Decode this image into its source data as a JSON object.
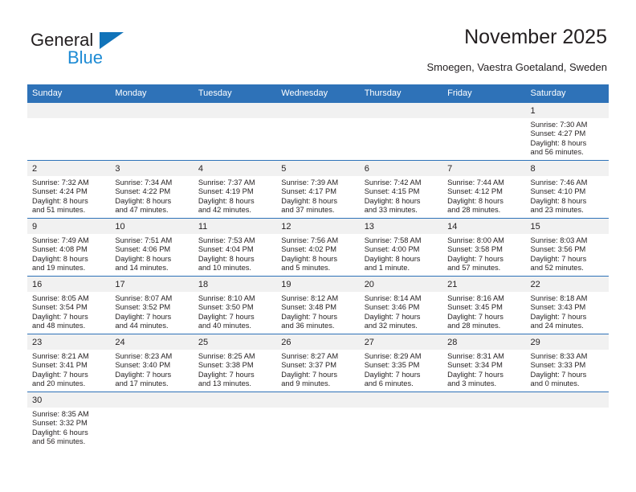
{
  "brand": {
    "name_top": "General",
    "name_bottom": "Blue"
  },
  "header": {
    "title": "November 2025",
    "subtitle": "Smoegen, Vaestra Goetaland, Sweden"
  },
  "colors": {
    "header_blue": "#2e72b8",
    "daynum_gray": "#f1f1f1",
    "logo_blue": "#1e8bd4",
    "text": "#231f20"
  },
  "calendar": {
    "weekday_headers": [
      "Sunday",
      "Monday",
      "Tuesday",
      "Wednesday",
      "Thursday",
      "Friday",
      "Saturday"
    ],
    "weeks": [
      [
        {
          "day": "",
          "sunrise": "",
          "sunset": "",
          "daylight1": "",
          "daylight2": ""
        },
        {
          "day": "",
          "sunrise": "",
          "sunset": "",
          "daylight1": "",
          "daylight2": ""
        },
        {
          "day": "",
          "sunrise": "",
          "sunset": "",
          "daylight1": "",
          "daylight2": ""
        },
        {
          "day": "",
          "sunrise": "",
          "sunset": "",
          "daylight1": "",
          "daylight2": ""
        },
        {
          "day": "",
          "sunrise": "",
          "sunset": "",
          "daylight1": "",
          "daylight2": ""
        },
        {
          "day": "",
          "sunrise": "",
          "sunset": "",
          "daylight1": "",
          "daylight2": ""
        },
        {
          "day": "1",
          "sunrise": "Sunrise: 7:30 AM",
          "sunset": "Sunset: 4:27 PM",
          "daylight1": "Daylight: 8 hours",
          "daylight2": "and 56 minutes."
        }
      ],
      [
        {
          "day": "2",
          "sunrise": "Sunrise: 7:32 AM",
          "sunset": "Sunset: 4:24 PM",
          "daylight1": "Daylight: 8 hours",
          "daylight2": "and 51 minutes."
        },
        {
          "day": "3",
          "sunrise": "Sunrise: 7:34 AM",
          "sunset": "Sunset: 4:22 PM",
          "daylight1": "Daylight: 8 hours",
          "daylight2": "and 47 minutes."
        },
        {
          "day": "4",
          "sunrise": "Sunrise: 7:37 AM",
          "sunset": "Sunset: 4:19 PM",
          "daylight1": "Daylight: 8 hours",
          "daylight2": "and 42 minutes."
        },
        {
          "day": "5",
          "sunrise": "Sunrise: 7:39 AM",
          "sunset": "Sunset: 4:17 PM",
          "daylight1": "Daylight: 8 hours",
          "daylight2": "and 37 minutes."
        },
        {
          "day": "6",
          "sunrise": "Sunrise: 7:42 AM",
          "sunset": "Sunset: 4:15 PM",
          "daylight1": "Daylight: 8 hours",
          "daylight2": "and 33 minutes."
        },
        {
          "day": "7",
          "sunrise": "Sunrise: 7:44 AM",
          "sunset": "Sunset: 4:12 PM",
          "daylight1": "Daylight: 8 hours",
          "daylight2": "and 28 minutes."
        },
        {
          "day": "8",
          "sunrise": "Sunrise: 7:46 AM",
          "sunset": "Sunset: 4:10 PM",
          "daylight1": "Daylight: 8 hours",
          "daylight2": "and 23 minutes."
        }
      ],
      [
        {
          "day": "9",
          "sunrise": "Sunrise: 7:49 AM",
          "sunset": "Sunset: 4:08 PM",
          "daylight1": "Daylight: 8 hours",
          "daylight2": "and 19 minutes."
        },
        {
          "day": "10",
          "sunrise": "Sunrise: 7:51 AM",
          "sunset": "Sunset: 4:06 PM",
          "daylight1": "Daylight: 8 hours",
          "daylight2": "and 14 minutes."
        },
        {
          "day": "11",
          "sunrise": "Sunrise: 7:53 AM",
          "sunset": "Sunset: 4:04 PM",
          "daylight1": "Daylight: 8 hours",
          "daylight2": "and 10 minutes."
        },
        {
          "day": "12",
          "sunrise": "Sunrise: 7:56 AM",
          "sunset": "Sunset: 4:02 PM",
          "daylight1": "Daylight: 8 hours",
          "daylight2": "and 5 minutes."
        },
        {
          "day": "13",
          "sunrise": "Sunrise: 7:58 AM",
          "sunset": "Sunset: 4:00 PM",
          "daylight1": "Daylight: 8 hours",
          "daylight2": "and 1 minute."
        },
        {
          "day": "14",
          "sunrise": "Sunrise: 8:00 AM",
          "sunset": "Sunset: 3:58 PM",
          "daylight1": "Daylight: 7 hours",
          "daylight2": "and 57 minutes."
        },
        {
          "day": "15",
          "sunrise": "Sunrise: 8:03 AM",
          "sunset": "Sunset: 3:56 PM",
          "daylight1": "Daylight: 7 hours",
          "daylight2": "and 52 minutes."
        }
      ],
      [
        {
          "day": "16",
          "sunrise": "Sunrise: 8:05 AM",
          "sunset": "Sunset: 3:54 PM",
          "daylight1": "Daylight: 7 hours",
          "daylight2": "and 48 minutes."
        },
        {
          "day": "17",
          "sunrise": "Sunrise: 8:07 AM",
          "sunset": "Sunset: 3:52 PM",
          "daylight1": "Daylight: 7 hours",
          "daylight2": "and 44 minutes."
        },
        {
          "day": "18",
          "sunrise": "Sunrise: 8:10 AM",
          "sunset": "Sunset: 3:50 PM",
          "daylight1": "Daylight: 7 hours",
          "daylight2": "and 40 minutes."
        },
        {
          "day": "19",
          "sunrise": "Sunrise: 8:12 AM",
          "sunset": "Sunset: 3:48 PM",
          "daylight1": "Daylight: 7 hours",
          "daylight2": "and 36 minutes."
        },
        {
          "day": "20",
          "sunrise": "Sunrise: 8:14 AM",
          "sunset": "Sunset: 3:46 PM",
          "daylight1": "Daylight: 7 hours",
          "daylight2": "and 32 minutes."
        },
        {
          "day": "21",
          "sunrise": "Sunrise: 8:16 AM",
          "sunset": "Sunset: 3:45 PM",
          "daylight1": "Daylight: 7 hours",
          "daylight2": "and 28 minutes."
        },
        {
          "day": "22",
          "sunrise": "Sunrise: 8:18 AM",
          "sunset": "Sunset: 3:43 PM",
          "daylight1": "Daylight: 7 hours",
          "daylight2": "and 24 minutes."
        }
      ],
      [
        {
          "day": "23",
          "sunrise": "Sunrise: 8:21 AM",
          "sunset": "Sunset: 3:41 PM",
          "daylight1": "Daylight: 7 hours",
          "daylight2": "and 20 minutes."
        },
        {
          "day": "24",
          "sunrise": "Sunrise: 8:23 AM",
          "sunset": "Sunset: 3:40 PM",
          "daylight1": "Daylight: 7 hours",
          "daylight2": "and 17 minutes."
        },
        {
          "day": "25",
          "sunrise": "Sunrise: 8:25 AM",
          "sunset": "Sunset: 3:38 PM",
          "daylight1": "Daylight: 7 hours",
          "daylight2": "and 13 minutes."
        },
        {
          "day": "26",
          "sunrise": "Sunrise: 8:27 AM",
          "sunset": "Sunset: 3:37 PM",
          "daylight1": "Daylight: 7 hours",
          "daylight2": "and 9 minutes."
        },
        {
          "day": "27",
          "sunrise": "Sunrise: 8:29 AM",
          "sunset": "Sunset: 3:35 PM",
          "daylight1": "Daylight: 7 hours",
          "daylight2": "and 6 minutes."
        },
        {
          "day": "28",
          "sunrise": "Sunrise: 8:31 AM",
          "sunset": "Sunset: 3:34 PM",
          "daylight1": "Daylight: 7 hours",
          "daylight2": "and 3 minutes."
        },
        {
          "day": "29",
          "sunrise": "Sunrise: 8:33 AM",
          "sunset": "Sunset: 3:33 PM",
          "daylight1": "Daylight: 7 hours",
          "daylight2": "and 0 minutes."
        }
      ],
      [
        {
          "day": "30",
          "sunrise": "Sunrise: 8:35 AM",
          "sunset": "Sunset: 3:32 PM",
          "daylight1": "Daylight: 6 hours",
          "daylight2": "and 56 minutes."
        },
        {
          "day": "",
          "sunrise": "",
          "sunset": "",
          "daylight1": "",
          "daylight2": ""
        },
        {
          "day": "",
          "sunrise": "",
          "sunset": "",
          "daylight1": "",
          "daylight2": ""
        },
        {
          "day": "",
          "sunrise": "",
          "sunset": "",
          "daylight1": "",
          "daylight2": ""
        },
        {
          "day": "",
          "sunrise": "",
          "sunset": "",
          "daylight1": "",
          "daylight2": ""
        },
        {
          "day": "",
          "sunrise": "",
          "sunset": "",
          "daylight1": "",
          "daylight2": ""
        },
        {
          "day": "",
          "sunrise": "",
          "sunset": "",
          "daylight1": "",
          "daylight2": ""
        }
      ]
    ]
  }
}
